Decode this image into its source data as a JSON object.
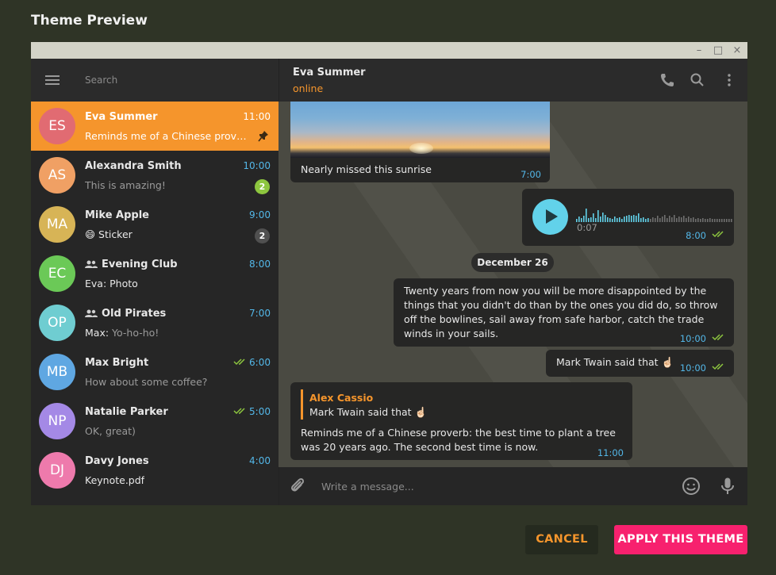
{
  "dialog": {
    "title": "Theme Preview",
    "cancel_label": "CANCEL",
    "apply_label": "APPLY THIS THEME"
  },
  "window_controls": {
    "minimize": "–",
    "maximize": "□",
    "close": "×"
  },
  "sidebar": {
    "search_placeholder": "Search",
    "chats": [
      {
        "initials": "ES",
        "name": "Eva Summer",
        "time": "11:00",
        "preview": "Reminds me of a Chinese proverb...",
        "avatar_color": "#e16b72",
        "active": true,
        "pinned": true
      },
      {
        "initials": "AS",
        "name": "Alexandra Smith",
        "time": "10:00",
        "preview": "This is amazing!",
        "avatar_color": "#f0a064",
        "badge": "2",
        "badge_color": "#8dc63f"
      },
      {
        "initials": "MA",
        "name": "Mike Apple",
        "time": "9:00",
        "preview": "😄 Sticker",
        "avatar_color": "#d7b456",
        "badge": "2",
        "badge_color": "#505050"
      },
      {
        "initials": "EC",
        "name": "Evening Club",
        "time": "8:00",
        "preview": "Eva: Photo",
        "avatar_color": "#6bc957",
        "group": true
      },
      {
        "initials": "OP",
        "name": "Old Pirates",
        "time": "7:00",
        "preview_sender": "Max:",
        "preview": "Yo-ho-ho!",
        "avatar_color": "#6fcdd1",
        "group": true
      },
      {
        "initials": "MB",
        "name": "Max Bright",
        "time": "6:00",
        "preview": "How about some coffee?",
        "avatar_color": "#5fa7e2",
        "read": true
      },
      {
        "initials": "NP",
        "name": "Natalie Parker",
        "time": "5:00",
        "preview": "OK, great)",
        "avatar_color": "#a489e6",
        "read": true
      },
      {
        "initials": "DJ",
        "name": "Davy Jones",
        "time": "4:00",
        "preview": "Keynote.pdf",
        "avatar_color": "#ee7aac"
      }
    ]
  },
  "chat": {
    "name": "Eva Summer",
    "status": "online",
    "composer_placeholder": "Write a message...",
    "messages": {
      "photo_caption": "Nearly missed this sunrise",
      "photo_time": "7:00",
      "voice_duration": "0:07",
      "voice_time": "8:00",
      "date_separator": "December 26",
      "quote_text": "Twenty years from now you will be more disappointed by the things that you didn't do than by the ones you did do, so throw off the bowlines, sail away from safe harbor, catch the trade winds in your sails.",
      "quote_time": "10:00",
      "twain_text": "Mark Twain said that ☝🏻",
      "twain_time": "10:00",
      "reply_author": "Alex Cassio",
      "reply_quoted": "Mark Twain said that ☝🏻",
      "reply_text": "Reminds me of a Chinese proverb: the best time to plant a tree was 20 years ago. The second best time is now.",
      "reply_time": "11:00"
    }
  },
  "colors": {
    "accent": "#f5952c",
    "apply": "#f7216e",
    "link": "#53b7e8",
    "voice": "#62d2ea",
    "read_ticks": "#8dc63f"
  }
}
